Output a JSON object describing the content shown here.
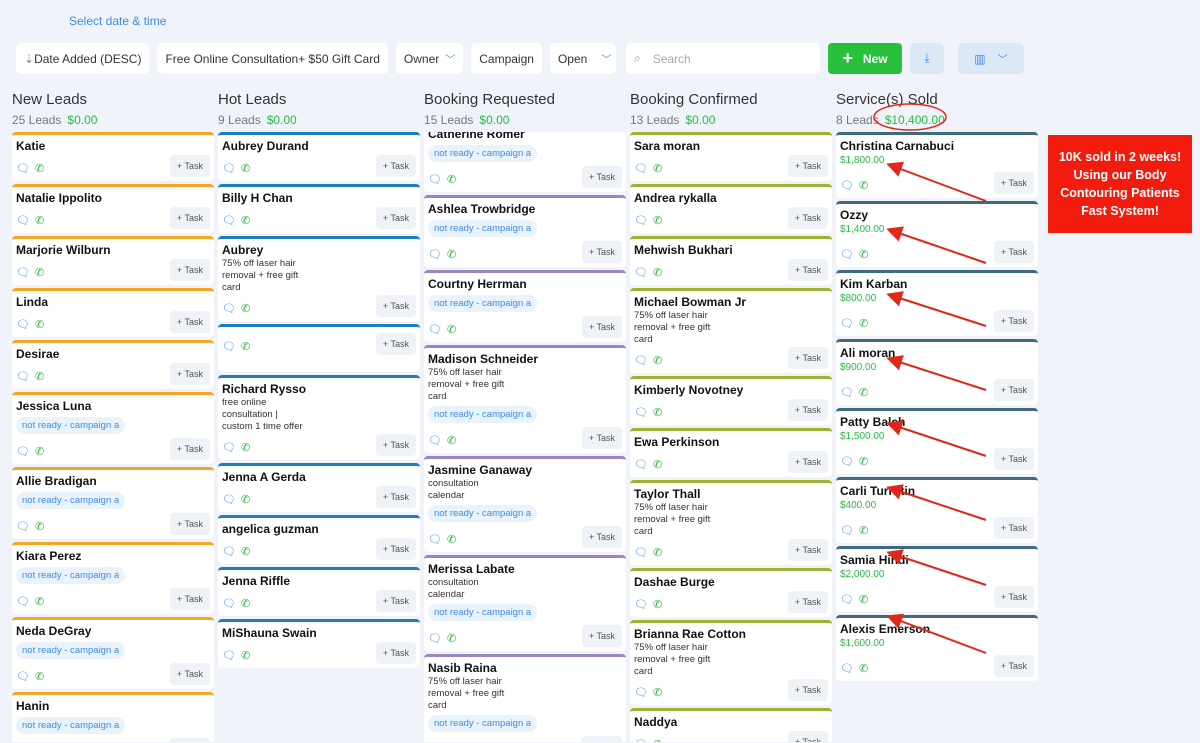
{
  "header": {
    "date_link": "Select date & time"
  },
  "toolbar": {
    "sort": "Date Added (DESC)",
    "pipeline": "Free Online Consultation+ $50 Gift Card",
    "owner": "Owner",
    "campaign": "Campaign",
    "status": "Open",
    "search_placeholder": "Search",
    "new_label": "New"
  },
  "promo": {
    "lines": [
      "10K sold in 2 weeks!",
      "Using our Body",
      "Contouring Patients",
      "Fast System!"
    ]
  },
  "colors": {
    "new": "#f5a623",
    "hot": "#1e7fc0",
    "req": "#9b86c3",
    "conf": "#9fb332",
    "sold": "#3e6b7e"
  },
  "task_label": "+ Task",
  "columns": [
    {
      "title": "New Leads",
      "count": "25 Leads",
      "amount": "$0.00",
      "color": "#f5a623",
      "cards": [
        {
          "name": "Katie"
        },
        {
          "name": "Natalie Ippolito"
        },
        {
          "name": "Marjorie Wilburn"
        },
        {
          "name": "Linda"
        },
        {
          "name": "Desirae"
        },
        {
          "name": "Jessica Luna",
          "tag": "not ready - campaign a"
        },
        {
          "name": "Allie Bradigan",
          "tag": "not ready - campaign a"
        },
        {
          "name": "Kiara Perez",
          "tag": "not ready - campaign a"
        },
        {
          "name": "Neda DeGray",
          "tag": "not ready - campaign a"
        },
        {
          "name": "Hanin",
          "tag": "not ready - campaign a"
        }
      ]
    },
    {
      "title": "Hot Leads",
      "count": "9 Leads",
      "amount": "$0.00",
      "color": "#1e7fc0",
      "cards": [
        {
          "name": "Aubrey Durand"
        },
        {
          "name": "Billy H Chan"
        },
        {
          "name": "Aubrey",
          "desc": [
            "75% off laser hair",
            "removal + free gift",
            "card"
          ]
        },
        {
          "name": ""
        },
        {
          "name": "Richard Rysso",
          "desc": [
            "free online",
            "consultation |",
            "custom 1 time offer"
          ]
        },
        {
          "name": "Jenna A Gerda"
        },
        {
          "name": "angelica guzman"
        },
        {
          "name": "Jenna Riffle"
        },
        {
          "name": "MiShauna Swain"
        }
      ]
    },
    {
      "title": "Booking Requested",
      "count": "15 Leads",
      "amount": "$0.00",
      "color": "#9b86c3",
      "cards": [
        {
          "name": "Catherine Romer",
          "tag": "not ready - campaign a"
        },
        {
          "name": "Ashlea Trowbridge",
          "tag": "not ready - campaign a"
        },
        {
          "name": "Courtny Herrman",
          "tag": "not ready - campaign a"
        },
        {
          "name": "Madison Schneider",
          "desc": [
            "75% off laser hair",
            "removal + free gift",
            "card"
          ],
          "tag": "not ready - campaign a"
        },
        {
          "name": "Jasmine Ganaway",
          "desc": [
            "consultation",
            "calendar"
          ],
          "tag": "not ready - campaign a"
        },
        {
          "name": "Merissa Labate",
          "desc": [
            "consultation",
            "calendar"
          ],
          "tag": "not ready - campaign a"
        },
        {
          "name": "Nasib Raina",
          "desc": [
            "75% off laser hair",
            "removal + free gift",
            "card"
          ],
          "tag": "not ready - campaign a"
        }
      ]
    },
    {
      "title": "Booking Confirmed",
      "count": "13 Leads",
      "amount": "$0.00",
      "color": "#9fb332",
      "cards": [
        {
          "name": "Sara moran"
        },
        {
          "name": "Andrea rykalla"
        },
        {
          "name": "Mehwish Bukhari"
        },
        {
          "name": "Michael Bowman Jr",
          "desc": [
            "75% off laser hair",
            "removal + free gift",
            "card"
          ]
        },
        {
          "name": "Kimberly Novotney"
        },
        {
          "name": "Ewa Perkinson"
        },
        {
          "name": "Taylor Thall",
          "desc": [
            "75% off laser hair",
            "removal + free gift",
            "card"
          ]
        },
        {
          "name": "Dashae Burge"
        },
        {
          "name": "Brianna Rae Cotton",
          "desc": [
            "75% off laser hair",
            "removal + free gift",
            "card"
          ]
        },
        {
          "name": "Naddya"
        }
      ]
    },
    {
      "title": "Service(s) Sold",
      "count": "8 Leads",
      "amount": "$10,400.00",
      "color": "#3e6b7e",
      "cards": [
        {
          "name": "Christina Carnabuci",
          "amount": "$1,800.00"
        },
        {
          "name": "Ozzy",
          "amount": "$1,400.00"
        },
        {
          "name": "Kim Karban",
          "amount": "$800.00"
        },
        {
          "name": "Ali moran",
          "amount": "$900.00"
        },
        {
          "name": "Patty Balch",
          "amount": "$1,500.00"
        },
        {
          "name": "Carli Turrittin",
          "amount": "$400.00"
        },
        {
          "name": "Samia Hindi",
          "amount": "$2,000.00"
        },
        {
          "name": "Alexis Emerson",
          "amount": "$1,600.00"
        }
      ]
    }
  ]
}
